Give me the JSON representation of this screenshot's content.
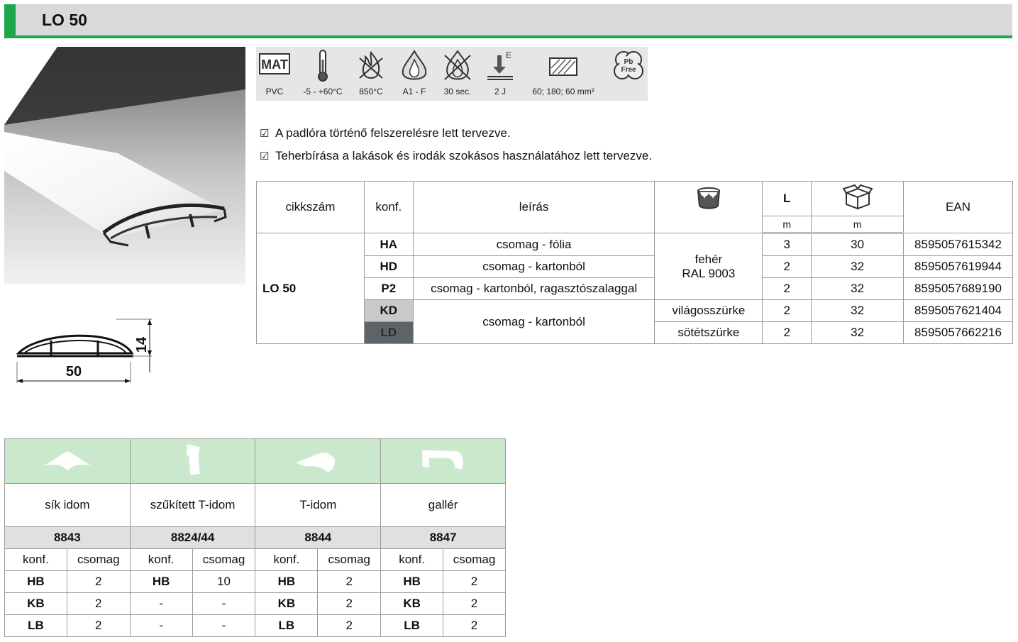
{
  "header": {
    "title": "LO 50"
  },
  "icons": [
    {
      "name": "mat-icon",
      "badge": "MAT",
      "label": "PVC"
    },
    {
      "name": "thermometer-icon",
      "label": "-5 - +60°C"
    },
    {
      "name": "fire-icon",
      "label": "850°C"
    },
    {
      "name": "flame-drop-icon",
      "label": "A1 - F"
    },
    {
      "name": "fire-time-icon",
      "label": "30 sec."
    },
    {
      "name": "impact-icon",
      "badge": "E",
      "label": "2 J"
    },
    {
      "name": "cross-section-icon",
      "label": "60; 180; 60 mm²"
    },
    {
      "name": "pb-free-icon",
      "badge": "Pb Free",
      "label": ""
    }
  ],
  "bullets": [
    "A padlóra történő felszerelésre lett tervezve.",
    "Teherbírása a lakások és irodák szokásos használatához lett tervezve."
  ],
  "drawing": {
    "width_label": "50",
    "height_label": "14"
  },
  "main_table": {
    "headers": {
      "code": "cikkszám",
      "conf": "konf.",
      "desc": "leírás",
      "L": "L",
      "L_unit": "m",
      "box_unit": "m",
      "ean": "EAN"
    },
    "product": "LO 50",
    "rows": [
      {
        "conf": "HA",
        "desc": "csomag - fólia",
        "L": "3",
        "box": "30",
        "ean": "8595057615342"
      },
      {
        "conf": "HD",
        "desc": "csomag - kartonból",
        "L": "2",
        "box": "32",
        "ean": "8595057619944"
      },
      {
        "conf": "P2",
        "desc": "csomag - kartonból, ragasztószalaggal",
        "L": "2",
        "box": "32",
        "ean": "8595057689190"
      },
      {
        "conf": "KD",
        "desc": "csomag - kartonból",
        "L": "2",
        "box": "32",
        "ean": "8595057621404"
      },
      {
        "conf": "LD",
        "desc": "",
        "L": "2",
        "box": "32",
        "ean": "8595057662216"
      }
    ],
    "colors": {
      "white_line1": "fehér",
      "white_line2": "RAL 9003",
      "light": "világosszürke",
      "dark": "sötétszürke"
    },
    "swatch_colors": {
      "KD": "#c9c9c9",
      "LD": "#5d6468"
    }
  },
  "accessories": {
    "items": [
      {
        "name": "sík idom",
        "number": "8843"
      },
      {
        "name": "szűkített T-idom",
        "number": "8824/44"
      },
      {
        "name": "T-idom",
        "number": "8844"
      },
      {
        "name": "gallér",
        "number": "8847"
      }
    ],
    "sub_headers": {
      "conf": "konf.",
      "pack": "csomag"
    },
    "rows": [
      [
        "HB",
        "2",
        "HB",
        "10",
        "HB",
        "2",
        "HB",
        "2"
      ],
      [
        "KB",
        "2",
        "-",
        "-",
        "KB",
        "2",
        "KB",
        "2"
      ],
      [
        "LB",
        "2",
        "-",
        "-",
        "LB",
        "2",
        "LB",
        "2"
      ]
    ]
  },
  "colors": {
    "accent": "#1fa64a",
    "header_bg": "#d9d9d9",
    "accessory_bg": "#c9e8cc"
  }
}
